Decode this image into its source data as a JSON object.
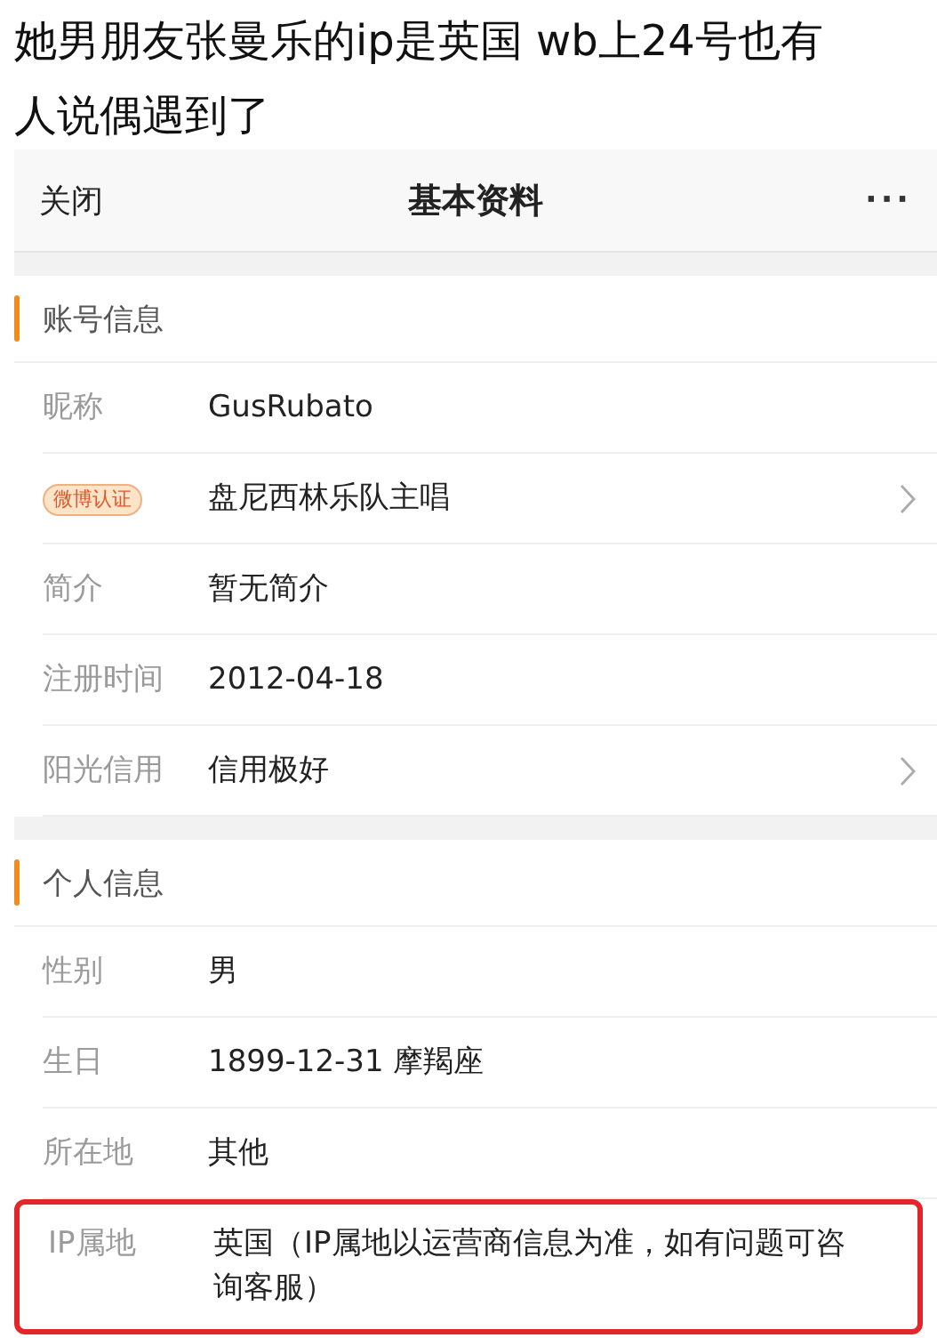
{
  "caption": "她男朋友张曼乐的ip是英国 wb上24号也有人说偶遇到了",
  "navbar": {
    "close": "关闭",
    "title": "基本资料",
    "more": "···"
  },
  "sections": [
    {
      "title": "账号信息",
      "rows": [
        {
          "kind": "text",
          "label": "昵称",
          "value": "GusRubato",
          "arrow": false,
          "highlighted": false
        },
        {
          "kind": "badge",
          "label": "微博认证",
          "value": "盘尼西林乐队主唱",
          "arrow": true,
          "highlighted": false
        },
        {
          "kind": "text",
          "label": "简介",
          "value": "暂无简介",
          "arrow": false,
          "highlighted": false
        },
        {
          "kind": "text",
          "label": "注册时间",
          "value": "2012-04-18",
          "arrow": false,
          "highlighted": false
        },
        {
          "kind": "text",
          "label": "阳光信用",
          "value": "信用极好",
          "arrow": true,
          "highlighted": false
        }
      ]
    },
    {
      "title": "个人信息",
      "rows": [
        {
          "kind": "text",
          "label": "性别",
          "value": "男",
          "arrow": false,
          "highlighted": false
        },
        {
          "kind": "text",
          "label": "生日",
          "value": "1899-12-31 摩羯座",
          "arrow": false,
          "highlighted": false
        },
        {
          "kind": "text",
          "label": "所在地",
          "value": "其他",
          "arrow": false,
          "highlighted": false
        },
        {
          "kind": "text",
          "label": "IP属地",
          "value": "英国（IP属地以运营商信息为准，如有问题可咨询客服）",
          "arrow": false,
          "highlighted": true
        }
      ]
    }
  ]
}
